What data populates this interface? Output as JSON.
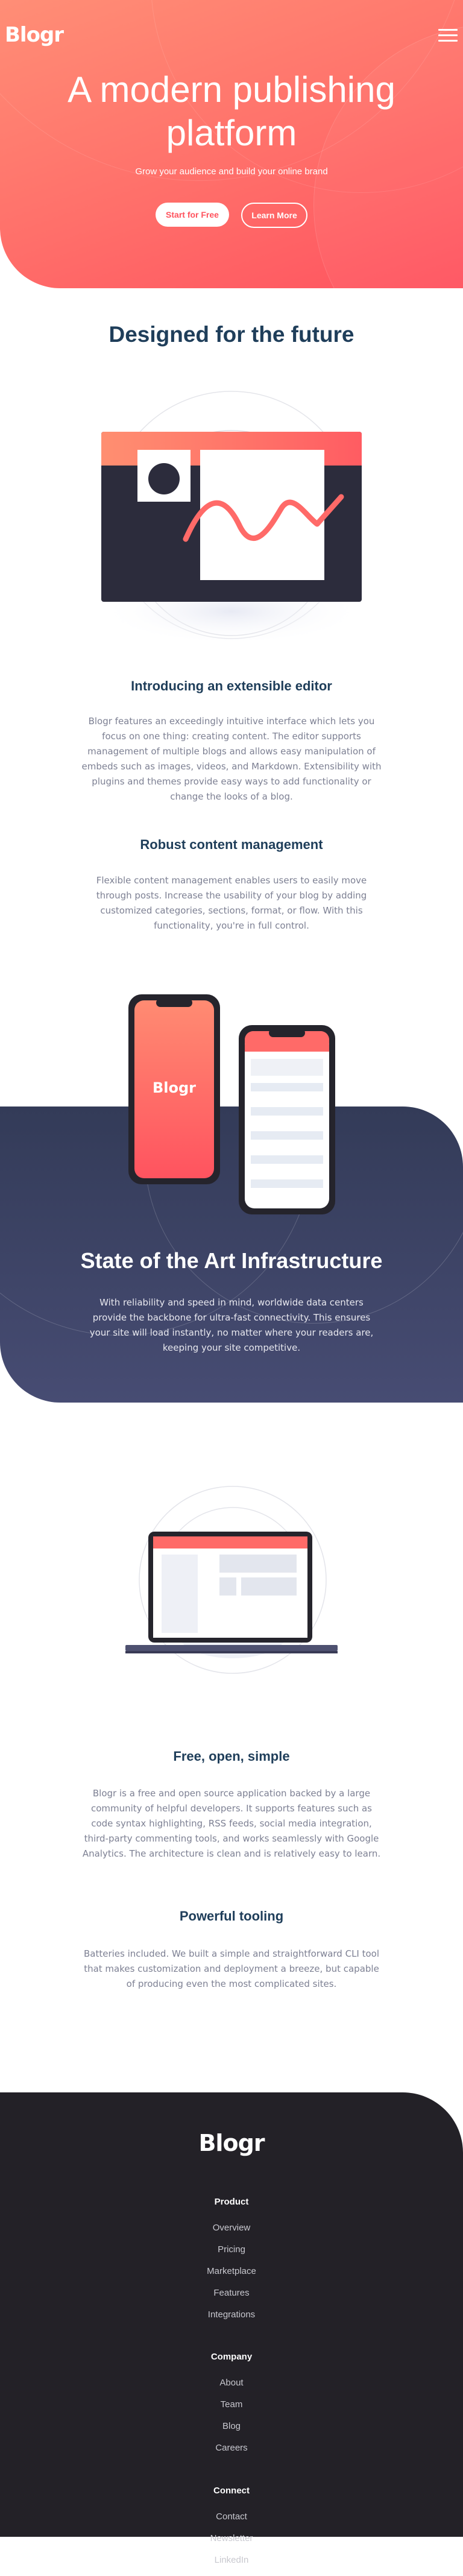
{
  "brand": "Blogr",
  "nav": {
    "menu_icon": "hamburger-menu-icon"
  },
  "hero": {
    "title_line1": "A modern publishing",
    "title_line2": "platform",
    "subtitle": "Grow your audience and build your online brand",
    "primary_btn": "Start for Free",
    "secondary_btn": "Learn More"
  },
  "designed": {
    "title": "Designed for the future",
    "features": [
      {
        "title": "Introducing an extensible editor",
        "text": "Blogr features an exceedingly intuitive interface which lets you focus on one thing: creating content. The editor supports management of multiple blogs and allows easy manipulation of embeds such as images, videos, and Markdown. Extensibility with plugins and themes provide easy ways to add functionality or change the looks of a blog."
      },
      {
        "title": "Robust content management",
        "text": "Flexible content management enables users to easily move through posts. Increase the usability of your blog by adding customized categories, sections, format, or flow. With this functionality, you're in full control."
      }
    ]
  },
  "infra": {
    "phone_logo": "Blogr",
    "title": "State of the Art Infrastructure",
    "text": "With reliability and speed in mind, worldwide data centers provide the backbone for ultra-fast connectivity. This ensures your site will load instantly, no matter where your readers are, keeping your site competitive."
  },
  "more": {
    "features": [
      {
        "title": "Free, open, simple",
        "text": "Blogr is a free and open source application backed by a large community of helpful developers. It supports features such as code syntax highlighting, RSS feeds, social media integration, third-party commenting tools, and works seamlessly with Google Analytics. The architecture is clean and is relatively easy to learn."
      },
      {
        "title": "Powerful tooling",
        "text": "Batteries included. We built a simple and straightforward CLI tool that makes customization and deployment a breeze, but capable of producing even the most complicated sites."
      }
    ]
  },
  "footer": {
    "logo": "Blogr",
    "product": {
      "heading": "Product",
      "links": [
        "Overview",
        "Pricing",
        "Marketplace",
        "Features",
        "Integrations"
      ]
    },
    "company": {
      "heading": "Company",
      "links": [
        "About",
        "Team",
        "Blog",
        "Careers"
      ]
    },
    "connect": {
      "heading": "Connect",
      "links": [
        "Contact",
        "Newsletter",
        "LinkedIn"
      ]
    }
  },
  "colors": {
    "accent": "#ff525d",
    "hero_gradient_start": "#ff8e76",
    "hero_gradient_end": "#ff535f",
    "heading": "#1f3e5a",
    "infra_bg": "#3a3f5f",
    "footer_bg": "#232127"
  }
}
